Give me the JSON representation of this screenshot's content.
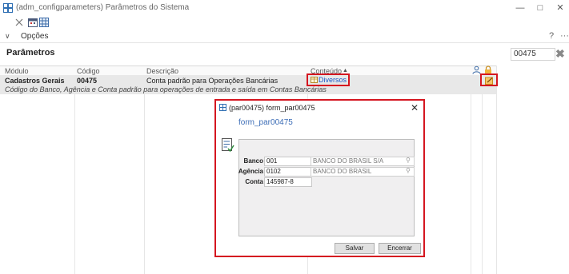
{
  "window": {
    "title": "(adm_configparameters)  Parâmetros do Sistema",
    "controls": [
      "minimize-icon",
      "maximize-icon",
      "close-icon"
    ]
  },
  "toolbar": {
    "icons": [
      "pin-icon",
      "calendar-icon",
      "grid-icon"
    ]
  },
  "options": {
    "label": "Opções",
    "help": "?",
    "more": "···"
  },
  "parameters": {
    "title": "Parâmetros",
    "search_value": "00475"
  },
  "grid": {
    "columns": [
      "Módulo",
      "Código",
      "Descrição",
      "Conteúdo"
    ],
    "row": {
      "module": "Cadastros Gerais",
      "code": "00475",
      "description": "Conta padrão para Operações Bancárias",
      "content": "Diversos",
      "long_description": "Código do Banco, Agência e Conta padrão para operações de entrada e saída em Contas Bancárias"
    }
  },
  "dialog": {
    "title": "(par00475)  form_par00475",
    "form_name": "form_par00475",
    "fields": [
      {
        "label": "Banco",
        "value": "001",
        "description": "BANCO DO BRASIL S/A"
      },
      {
        "label": "Agência",
        "value": "0102",
        "description": "BANCO DO BRASIL"
      },
      {
        "label": "Conta",
        "value": "145987-8"
      }
    ],
    "save_label": "Salvar",
    "close_label": "Encerrar"
  },
  "colors": {
    "highlight": "#d51620",
    "link": "#1a56c8",
    "form_title": "#3b6cb6"
  }
}
